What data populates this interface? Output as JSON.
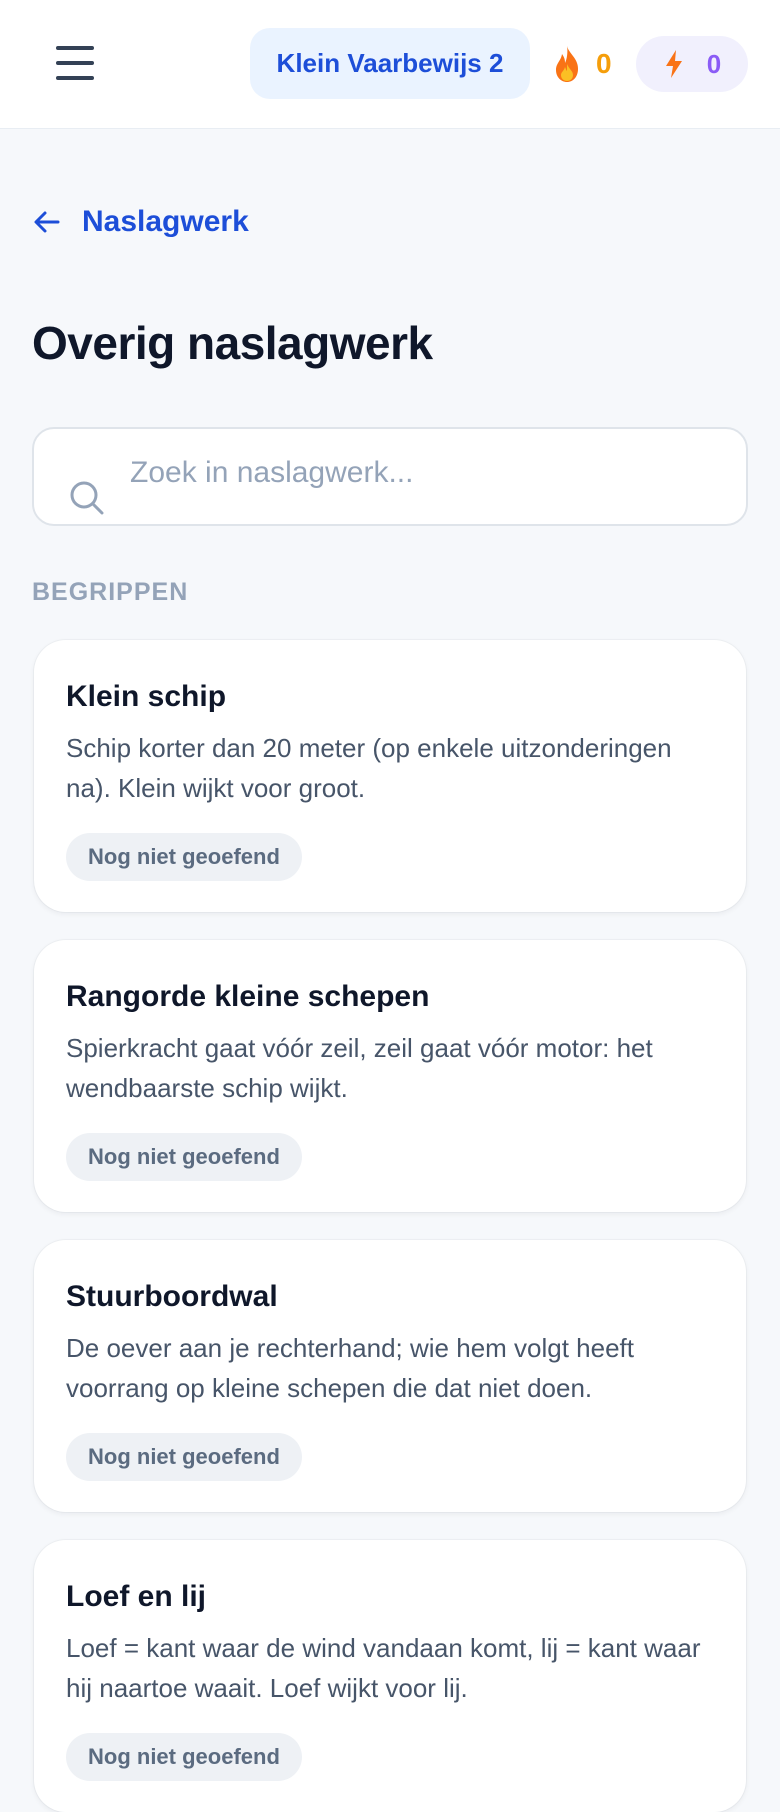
{
  "header": {
    "menu_icon": "hamburger-menu-icon",
    "course_label": "Klein Vaarbewijs 2",
    "streak_icon": "flame-icon",
    "streak_count": "0",
    "xp_icon": "lightning-bolt-icon",
    "xp_count": "0",
    "colors": {
      "accent": "#1d4ed8",
      "streak": "#f59e0b",
      "xp": "#8b5cf6"
    }
  },
  "nav": {
    "back_icon": "arrow-left-icon",
    "back_label": "Naslagwerk"
  },
  "page": {
    "title": "Overig naslagwerk"
  },
  "search": {
    "icon": "search-icon",
    "placeholder": "Zoek in naslagwerk...",
    "value": ""
  },
  "section": {
    "label": "BEGRIPPEN",
    "items": [
      {
        "title": "Klein schip",
        "description": "Schip korter dan 20 meter (op enkele uitzonderingen na). Klein wijkt voor groot.",
        "status": "Nog niet geoefend"
      },
      {
        "title": "Rangorde kleine schepen",
        "description": "Spierkracht gaat vóór zeil, zeil gaat vóór motor: het wendbaarste schip wijkt.",
        "status": "Nog niet geoefend"
      },
      {
        "title": "Stuurboordwal",
        "description": "De oever aan je rechterhand; wie hem volgt heeft voorrang op kleine schepen die dat niet doen.",
        "status": "Nog niet geoefend"
      },
      {
        "title": "Loef en lij",
        "description": "Loef = kant waar de wind vandaan komt, lij = kant waar hij naartoe waait. Loef wijkt voor lij.",
        "status": "Nog niet geoefend"
      }
    ]
  }
}
